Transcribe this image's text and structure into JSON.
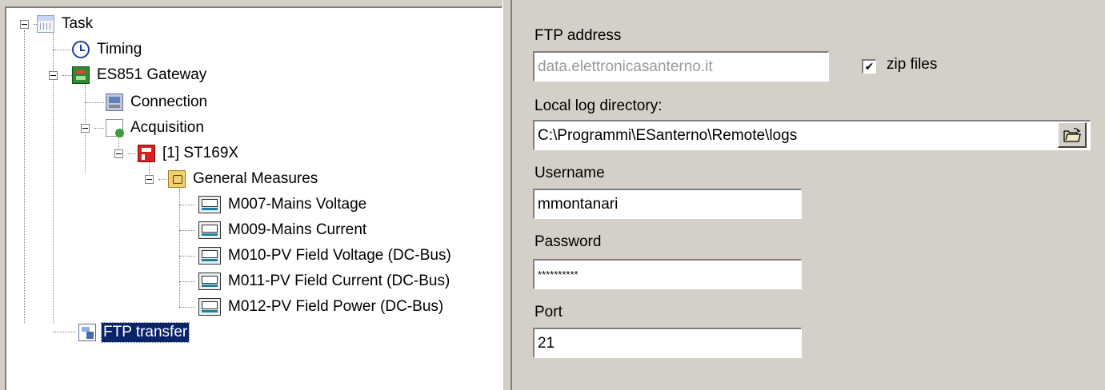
{
  "tree": {
    "task": "Task",
    "timing": "Timing",
    "gateway": "ES851 Gateway",
    "connection": "Connection",
    "acquisition": "Acquisition",
    "device": "[1] ST169X",
    "general_measures": "General Measures",
    "measures": [
      "M007-Mains Voltage",
      "M009-Mains Current",
      "M010-PV Field Voltage (DC-Bus)",
      "M011-PV Field Current (DC-Bus)",
      "M012-PV Field Power (DC-Bus)"
    ],
    "ftp_transfer": "FTP transfer",
    "selected": "FTP transfer"
  },
  "form": {
    "ftp_address_label": "FTP address",
    "ftp_address_value": "data.elettronicasanterno.it",
    "zip_label": "zip files",
    "zip_checked": true,
    "zip_mark": "✔",
    "local_log_label": "Local log directory:",
    "local_log_value": "C:\\Programmi\\ESanterno\\Remote\\logs",
    "username_label": "Username",
    "username_value": "mmontanari",
    "password_label": "Password",
    "password_value": "**********",
    "port_label": "Port",
    "port_value": "21"
  },
  "icons": {
    "task": "calendar-icon",
    "timing": "clock-icon",
    "gateway": "gateway-icon",
    "connection": "connection-icon",
    "acquisition": "acquisition-icon",
    "device": "device-icon",
    "folder": "folder-icon",
    "measure": "meter-icon",
    "ftp": "ftp-icon",
    "browse": "open-folder-icon"
  }
}
